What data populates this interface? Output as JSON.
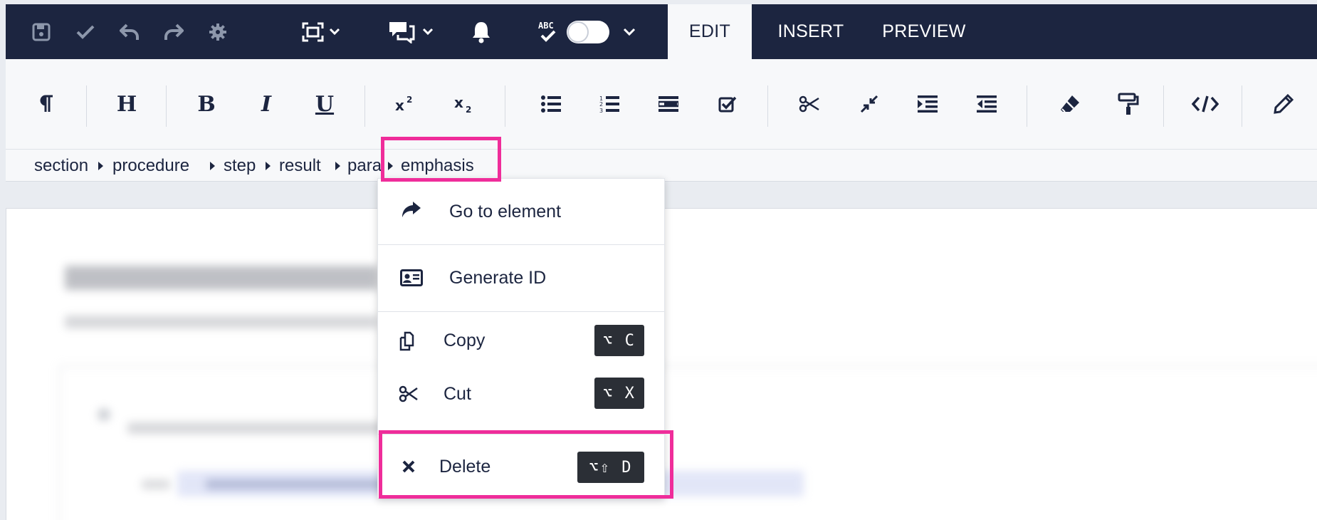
{
  "tabs": {
    "edit": "EDIT",
    "insert": "INSERT",
    "preview": "PREVIEW"
  },
  "toolbar": {
    "heading": "H",
    "bold": "B",
    "italic": "I",
    "underline": "U"
  },
  "breadcrumb": [
    "section",
    "procedure",
    "step",
    "result",
    "para",
    "emphasis"
  ],
  "menu": {
    "goto": "Go to element",
    "genid": "Generate ID",
    "copy": "Copy",
    "copy_kbd": "⌥ C",
    "cut": "Cut",
    "cut_kbd": "⌥ X",
    "delete": "Delete",
    "delete_kbd": "⌥⇧ D"
  },
  "colors": {
    "topbar": "#1c2540",
    "highlight": "#ef2d9a",
    "kbd": "#2b2f36"
  }
}
